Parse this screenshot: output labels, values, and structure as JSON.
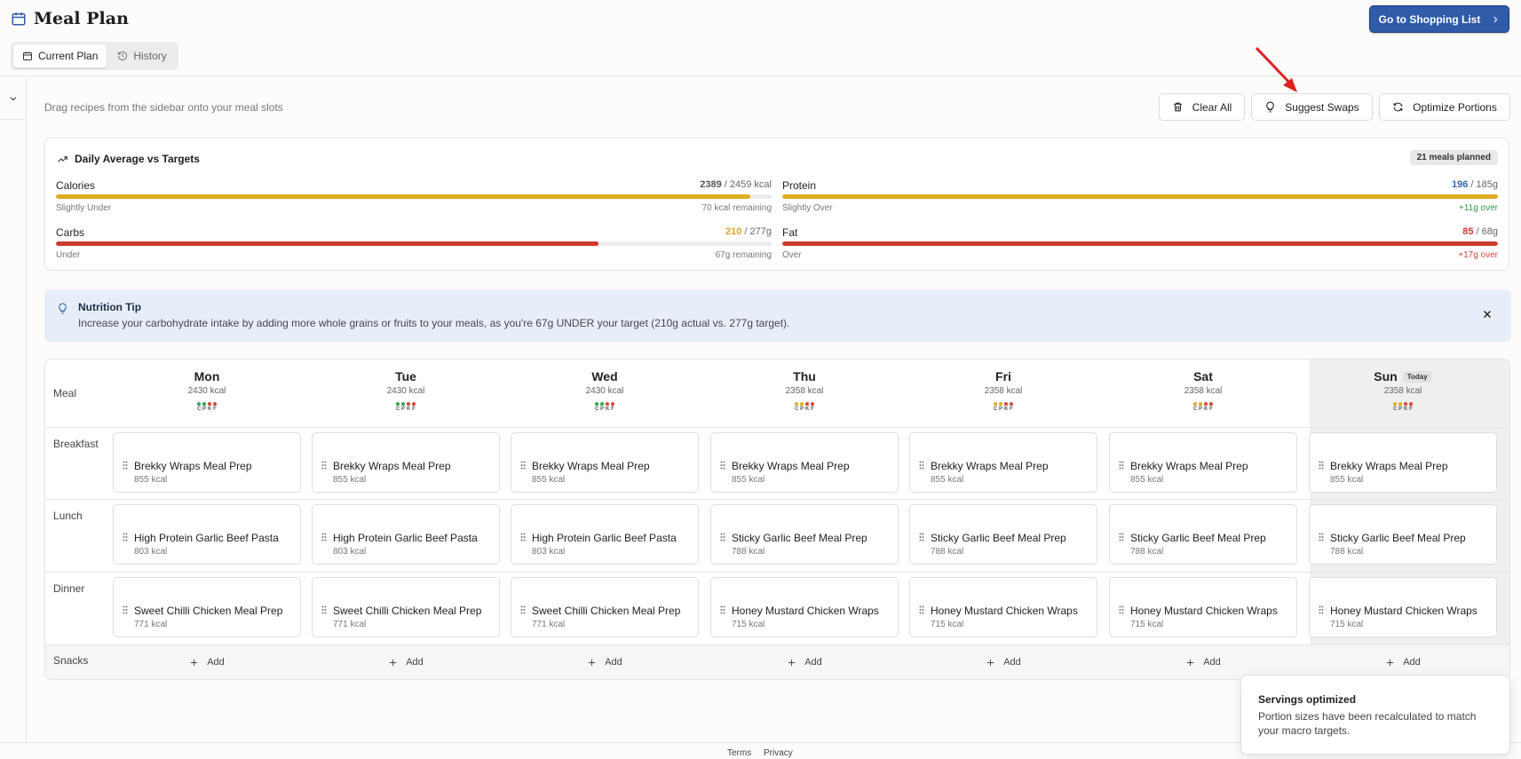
{
  "header": {
    "title": "Meal Plan",
    "tabs": [
      {
        "label": "Current Plan",
        "icon": "calendar-icon",
        "active": true
      },
      {
        "label": "History",
        "icon": "history-icon",
        "active": false
      }
    ],
    "shopping_button": "Go to Shopping List"
  },
  "toolbar": {
    "hint": "Drag recipes from the sidebar onto your meal slots",
    "clear_all": "Clear All",
    "suggest_swaps": "Suggest Swaps",
    "optimize_portions": "Optimize Portions"
  },
  "averages": {
    "title": "Daily Average vs Targets",
    "badge": "21 meals planned",
    "macros": [
      {
        "name": "Calories",
        "actual": "2389",
        "target": " / 2459 kcal",
        "status": "Slightly Under",
        "remaining": "70 kcal remaining",
        "progress": 0.97,
        "bar_color": "#e0ac22",
        "value_color": "#555555",
        "remaining_color": "#777777"
      },
      {
        "name": "Protein",
        "actual": "196",
        "target": " / 185g",
        "status": "Slightly Over",
        "remaining": "+11g over",
        "progress": 1.0,
        "bar_color": "#e0ac22",
        "value_color": "#3465b0",
        "remaining_color": "#2e9a4c"
      },
      {
        "name": "Carbs",
        "actual": "210",
        "target": " / 277g",
        "status": "Under",
        "remaining": "67g remaining",
        "progress": 0.758,
        "bar_color": "#cc3a2e",
        "value_color": "#e0a020",
        "remaining_color": "#777777"
      },
      {
        "name": "Fat",
        "actual": "85",
        "target": " / 68g",
        "status": "Over",
        "remaining": "+17g over",
        "progress": 1.0,
        "bar_color": "#cc3a2e",
        "value_color": "#cc3a2e",
        "remaining_color": "#d9453a"
      }
    ]
  },
  "tip": {
    "title": "Nutrition Tip",
    "text": "Increase your carbohydrate intake by adding more whole grains or fruits to your meals, as you're 67g UNDER your target (210g actual vs. 277g target)."
  },
  "grid": {
    "meal_header": "Meal",
    "today_badge": "Today",
    "macro_letters": [
      "C",
      "P",
      "K",
      "F"
    ],
    "rows": [
      "Breakfast",
      "Lunch",
      "Dinner",
      "Snacks"
    ],
    "add_label": "Add",
    "days": [
      {
        "name": "Mon",
        "kcal": "2430 kcal",
        "today": false,
        "dots": [
          "#2ea84f",
          "#2ea84f",
          "#d9453a",
          "#d9453a"
        ],
        "meals": [
          {
            "name": "Brekky Wraps Meal Prep",
            "kcal": "855 kcal"
          },
          {
            "name": "High Protein Garlic Beef Pasta",
            "kcal": "803 kcal"
          },
          {
            "name": "Sweet Chilli Chicken Meal Prep",
            "kcal": "771 kcal"
          }
        ]
      },
      {
        "name": "Tue",
        "kcal": "2430 kcal",
        "today": false,
        "dots": [
          "#2ea84f",
          "#2ea84f",
          "#d9453a",
          "#d9453a"
        ],
        "meals": [
          {
            "name": "Brekky Wraps Meal Prep",
            "kcal": "855 kcal"
          },
          {
            "name": "High Protein Garlic Beef Pasta",
            "kcal": "803 kcal"
          },
          {
            "name": "Sweet Chilli Chicken Meal Prep",
            "kcal": "771 kcal"
          }
        ]
      },
      {
        "name": "Wed",
        "kcal": "2430 kcal",
        "today": false,
        "dots": [
          "#2ea84f",
          "#2ea84f",
          "#d9453a",
          "#d9453a"
        ],
        "meals": [
          {
            "name": "Brekky Wraps Meal Prep",
            "kcal": "855 kcal"
          },
          {
            "name": "High Protein Garlic Beef Pasta",
            "kcal": "803 kcal"
          },
          {
            "name": "Sweet Chilli Chicken Meal Prep",
            "kcal": "771 kcal"
          }
        ]
      },
      {
        "name": "Thu",
        "kcal": "2358 kcal",
        "today": false,
        "dots": [
          "#e0ac22",
          "#e0ac22",
          "#d9453a",
          "#d9453a"
        ],
        "meals": [
          {
            "name": "Brekky Wraps Meal Prep",
            "kcal": "855 kcal"
          },
          {
            "name": "Sticky Garlic Beef Meal Prep",
            "kcal": "788 kcal"
          },
          {
            "name": "Honey Mustard Chicken Wraps",
            "kcal": "715 kcal"
          }
        ]
      },
      {
        "name": "Fri",
        "kcal": "2358 kcal",
        "today": false,
        "dots": [
          "#e0ac22",
          "#e0ac22",
          "#d9453a",
          "#d9453a"
        ],
        "meals": [
          {
            "name": "Brekky Wraps Meal Prep",
            "kcal": "855 kcal"
          },
          {
            "name": "Sticky Garlic Beef Meal Prep",
            "kcal": "788 kcal"
          },
          {
            "name": "Honey Mustard Chicken Wraps",
            "kcal": "715 kcal"
          }
        ]
      },
      {
        "name": "Sat",
        "kcal": "2358 kcal",
        "today": false,
        "dots": [
          "#e0ac22",
          "#e0ac22",
          "#d9453a",
          "#d9453a"
        ],
        "meals": [
          {
            "name": "Brekky Wraps Meal Prep",
            "kcal": "855 kcal"
          },
          {
            "name": "Sticky Garlic Beef Meal Prep",
            "kcal": "788 kcal"
          },
          {
            "name": "Honey Mustard Chicken Wraps",
            "kcal": "715 kcal"
          }
        ]
      },
      {
        "name": "Sun",
        "kcal": "2358 kcal",
        "today": true,
        "dots": [
          "#e0ac22",
          "#e0ac22",
          "#d9453a",
          "#d9453a"
        ],
        "meals": [
          {
            "name": "Brekky Wraps Meal Prep",
            "kcal": "855 kcal"
          },
          {
            "name": "Sticky Garlic Beef Meal Prep",
            "kcal": "788 kcal"
          },
          {
            "name": "Honey Mustard Chicken Wraps",
            "kcal": "715 kcal"
          }
        ]
      }
    ]
  },
  "footer": {
    "terms": "Terms",
    "privacy": "Privacy"
  },
  "toast": {
    "title": "Servings optimized",
    "text": "Portion sizes have been recalculated to match your macro targets."
  },
  "colors": {
    "accent": "#2f5ba8",
    "annotation_arrow": "#e02020"
  }
}
